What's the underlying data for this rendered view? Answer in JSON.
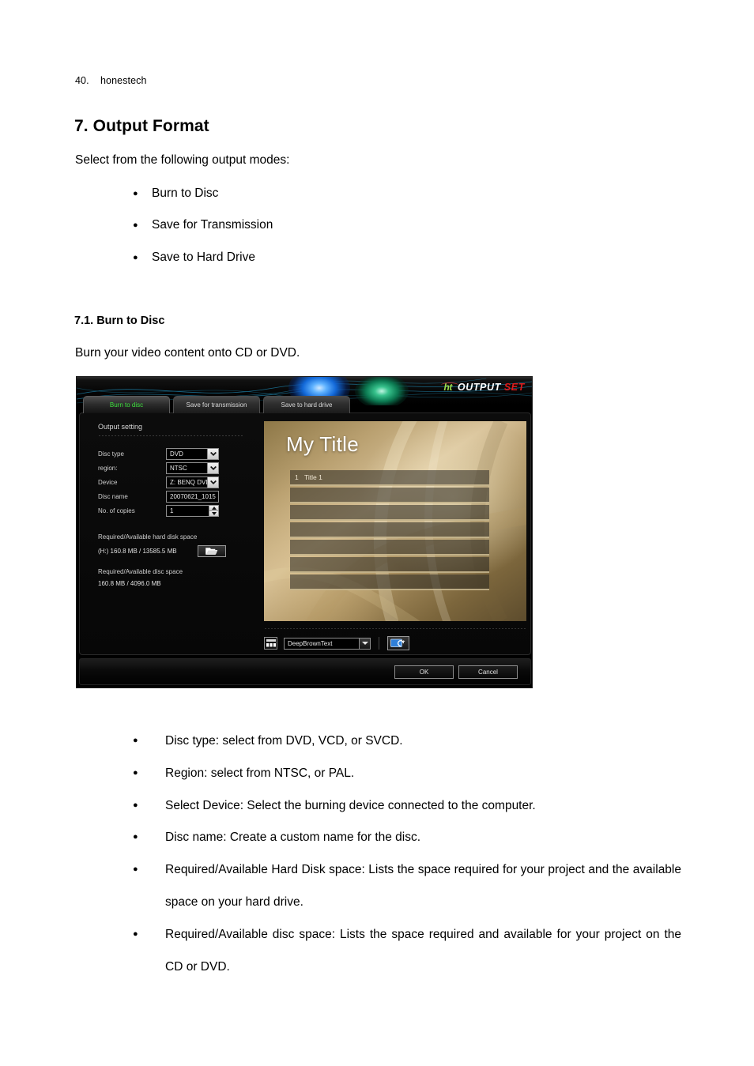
{
  "document": {
    "page_number": "40.",
    "brand": "honestech",
    "section_heading": "7. Output Format",
    "intro": "Select from the following output modes:",
    "mode_bullets": [
      "Burn to Disc",
      "Save for Transmission",
      "Save to Hard Drive"
    ],
    "subsection_heading": "7.1. Burn to Disc",
    "subsection_intro": "Burn your video content onto CD or DVD.",
    "description_bullets": [
      "Disc type: select from DVD, VCD, or SVCD.",
      "Region: select from NTSC, or PAL.",
      "Select Device: Select the burning device connected to the computer.",
      "Disc name: Create a custom name for the disc.",
      "Required/Available Hard Disk space: Lists the space required for your project and the available space on your hard drive.",
      "Required/Available disc space: Lists the space required and available for your project on the CD or DVD."
    ]
  },
  "app": {
    "logo": {
      "mark": "ht",
      "word1": "OUTPUT",
      "word2": "SET",
      "colors": {
        "mark": "#9ddc4a",
        "word1": "#ffffff",
        "word2": "#e01b1b"
      }
    },
    "tabs": [
      {
        "label": "Burn to disc",
        "active": true
      },
      {
        "label": "Save for transmission",
        "active": false
      },
      {
        "label": "Save to hard drive",
        "active": false
      }
    ],
    "panel_title": "Output setting",
    "form": [
      {
        "label": "Disc type",
        "value": "DVD",
        "control": "dropdown"
      },
      {
        "label": "region:",
        "value": "NTSC",
        "control": "dropdown"
      },
      {
        "label": "Device",
        "value": "Z: BENQ   DVD D",
        "control": "dropdown"
      },
      {
        "label": "Disc name",
        "value": "20070621_1015",
        "control": "text"
      },
      {
        "label": "No. of copies",
        "value": "1",
        "control": "spinner"
      }
    ],
    "hard_disk": {
      "label": "Required/Available hard disk space",
      "value": "(H:)  160.8 MB / 13585.5 MB",
      "browse_icon": "folder-icon"
    },
    "disc_space": {
      "label": "Required/Available disc space",
      "value": "160.8 MB / 4096.0 MB"
    },
    "preview": {
      "title": "My Title",
      "menu_rows": [
        {
          "num": "1",
          "label": "Title 1"
        },
        {
          "num": "",
          "label": ""
        },
        {
          "num": "",
          "label": ""
        },
        {
          "num": "",
          "label": ""
        },
        {
          "num": "",
          "label": ""
        },
        {
          "num": "",
          "label": ""
        },
        {
          "num": "",
          "label": ""
        }
      ]
    },
    "toolbar": {
      "grid_icon": "grid-layout-icon",
      "theme": "DeepBrownText",
      "preview_icon": "preview-refresh-icon"
    },
    "footer": {
      "ok": "OK",
      "cancel": "Cancel"
    },
    "accents": {
      "active_tab_text": "#3de23d",
      "glow_blue": "#1268d8",
      "glow_green": "#0c7a52",
      "wave": "#1d7fa6"
    }
  }
}
